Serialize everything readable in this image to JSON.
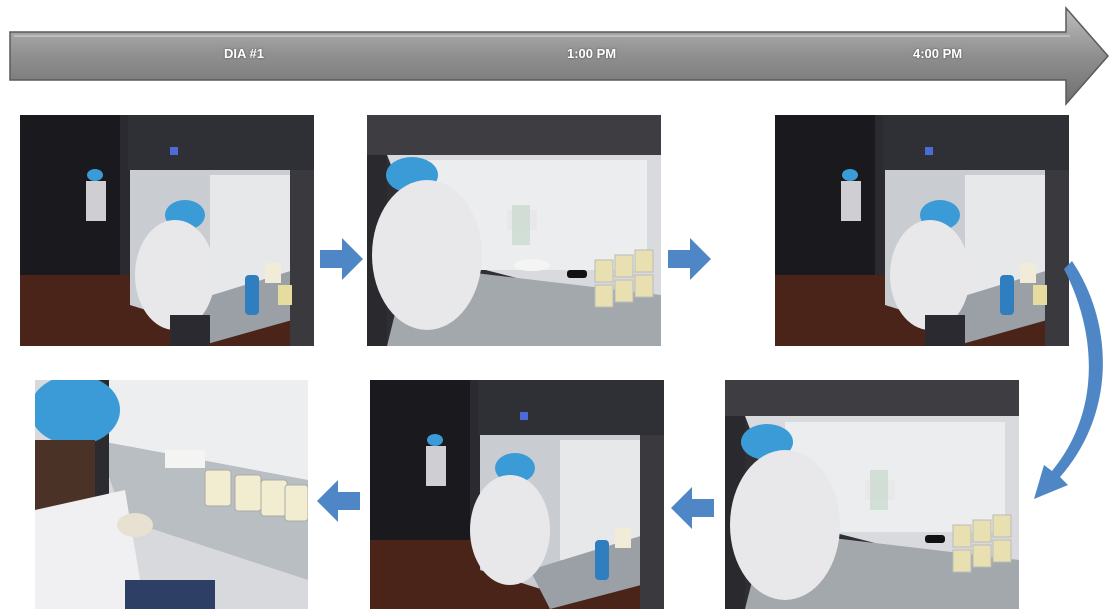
{
  "timeline": {
    "labels": [
      "DIA #1",
      "1:00 PM",
      "4:00 PM"
    ],
    "fill_color": "#8f8f8f"
  },
  "photos": [
    {
      "name": "photo-1",
      "scene": "wide lab view, technician at laminar flow hood"
    },
    {
      "name": "photo-2",
      "scene": "close view, technician handling plates beside jars"
    },
    {
      "name": "photo-3",
      "scene": "wide lab view, technician at laminar flow hood"
    },
    {
      "name": "photo-4",
      "scene": "close view, technician with jars in hood"
    },
    {
      "name": "photo-5",
      "scene": "wide lab view, technician at laminar flow hood"
    },
    {
      "name": "photo-6",
      "scene": "close-up of technician holding sample jars"
    }
  ],
  "colors": {
    "arrow_blue": "#4f86c6",
    "hairnet_blue": "#3a9bd6",
    "coat": "#e8e8ea"
  }
}
